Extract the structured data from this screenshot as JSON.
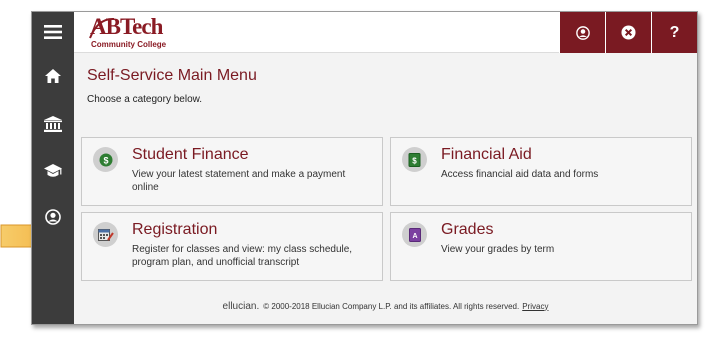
{
  "header": {
    "logo_text": "ABTech",
    "logo_sub": "Community College",
    "user_icon": "user-circle-icon",
    "signout_icon": "close-circle-icon",
    "help_label": "?"
  },
  "sidebar": {
    "items": [
      {
        "icon": "menu-icon"
      },
      {
        "icon": "home-icon"
      },
      {
        "icon": "bank-icon"
      },
      {
        "icon": "graduation-cap-icon"
      },
      {
        "icon": "user-circle-icon"
      }
    ]
  },
  "main": {
    "title": "Self-Service Main Menu",
    "subtitle": "Choose a category below.",
    "cards": [
      {
        "title": "Student Finance",
        "desc": "View your latest statement and make a payment online",
        "icon": "dollar-icon"
      },
      {
        "title": "Financial Aid",
        "desc": "Access financial aid data and forms",
        "icon": "money-document-icon"
      },
      {
        "title": "Registration",
        "desc": "Register for classes and view: my class schedule, program plan, and unofficial transcript",
        "icon": "calendar-edit-icon"
      },
      {
        "title": "Grades",
        "desc": "View your grades by term",
        "icon": "grade-book-icon"
      }
    ]
  },
  "footer": {
    "brand": "ellucian.",
    "text": "© 2000-2018 Ellucian Company L.P. and its affiliates. All rights reserved.",
    "link": "Privacy"
  },
  "colors": {
    "accent": "#7a1a22",
    "sidebar": "#3c3c3c",
    "arrow": "#f2b33d"
  }
}
